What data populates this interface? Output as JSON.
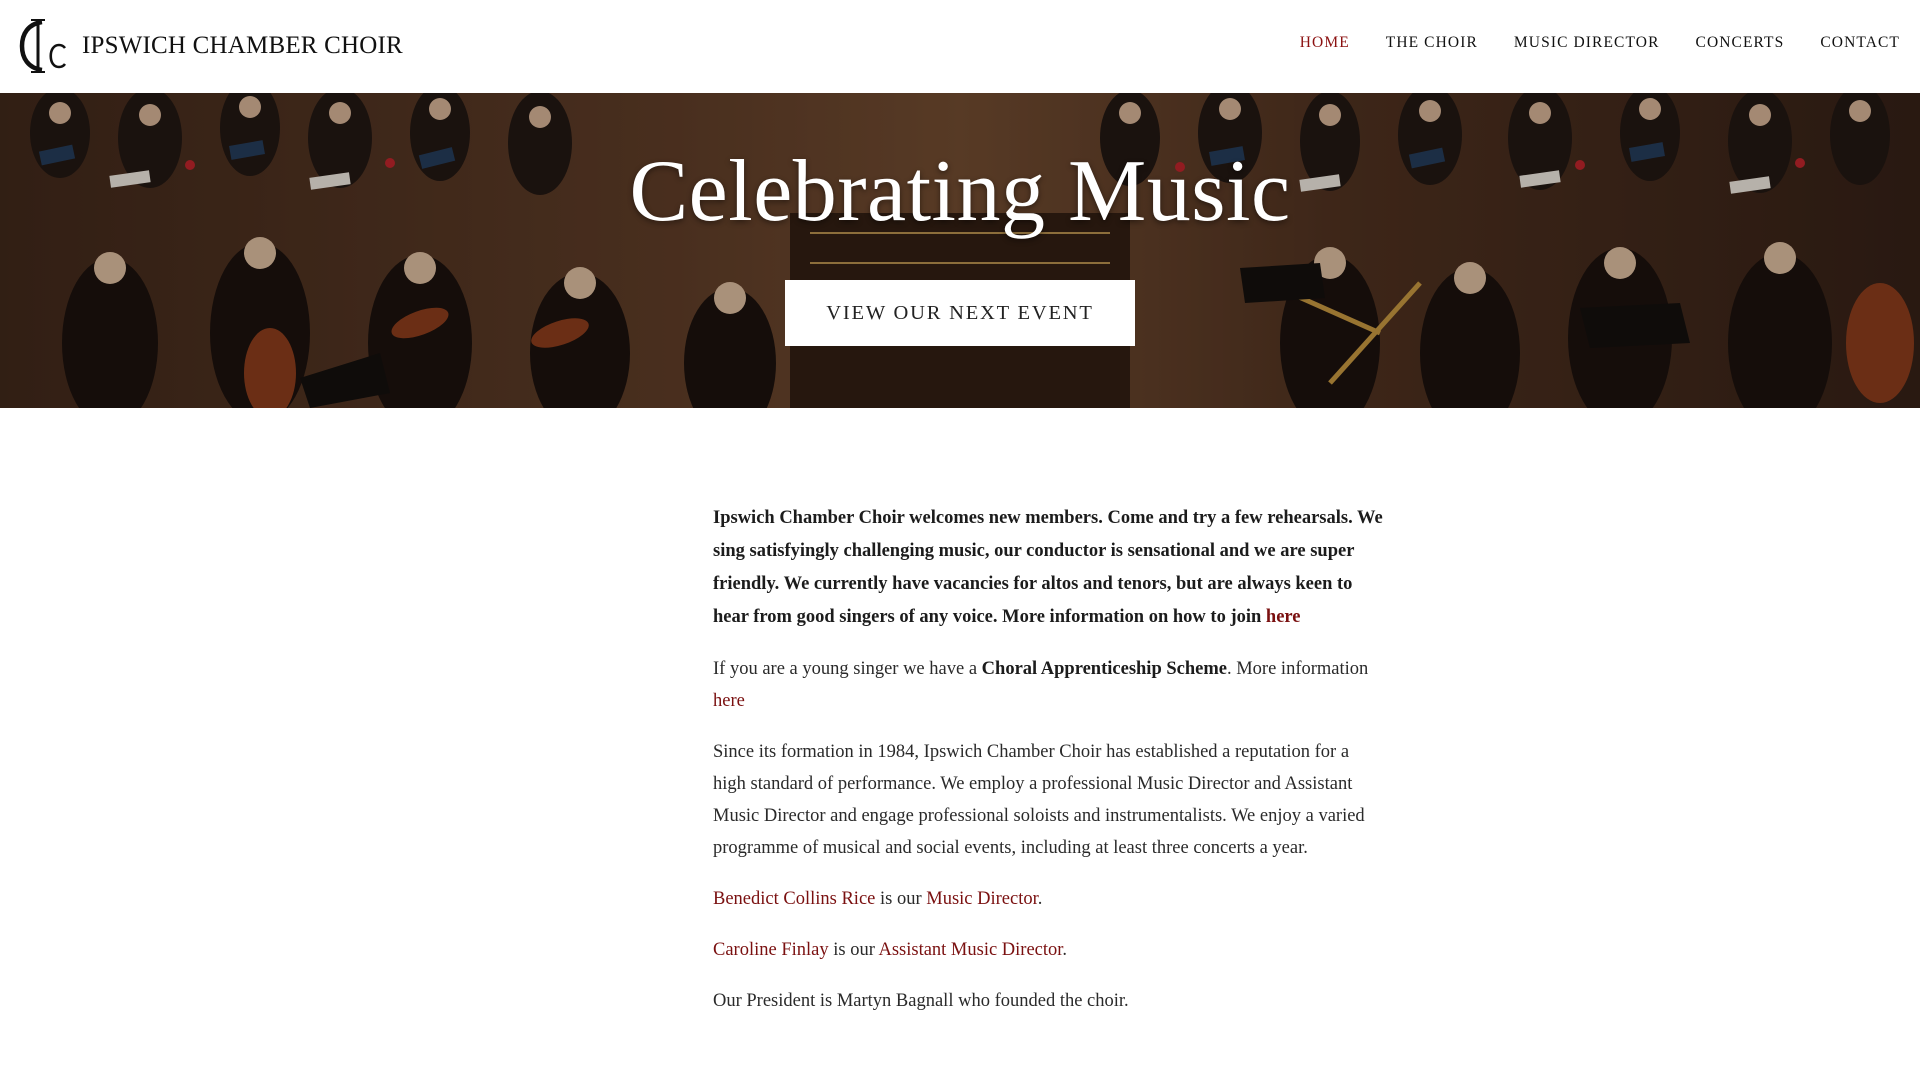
{
  "site": {
    "name": "IPSWICH CHAMBER CHOIR",
    "colors": {
      "accent": "#8b1111",
      "link": "#7a1010",
      "text": "#222222",
      "background": "#ffffff"
    }
  },
  "nav": {
    "items": [
      {
        "label": "HOME",
        "active": true
      },
      {
        "label": "THE CHOIR",
        "active": false
      },
      {
        "label": "MUSIC DIRECTOR",
        "active": false
      },
      {
        "label": "CONCERTS",
        "active": false
      },
      {
        "label": "CONTACT",
        "active": false
      }
    ]
  },
  "hero": {
    "title": "Celebrating Music",
    "button_label": "VIEW OUR NEXT EVENT"
  },
  "content": {
    "welcome_text": "Ipswich Chamber Choir welcomes new members.  Come and try a few rehearsals.  We sing satisfyingly challenging music, our conductor is sensational and we are super friendly.  We currently have vacancies for altos and tenors, but are always keen to hear from good singers of any voice.  More information on how to join ",
    "welcome_link": "here",
    "apprentice_text_1": "If you are a young singer we have a ",
    "apprentice_bold": "Choral Apprenticeship Scheme",
    "apprentice_text_2": ".  More information ",
    "apprentice_link": "here",
    "history": "Since its formation in 1984, Ipswich Chamber Choir has established a reputation for a high standard of performance. We employ a professional Music Director and Assistant Music Director and engage professional soloists and instrumentalists.  We enjoy a varied programme of musical and social events, including at least three concerts a year.",
    "director_name": "Benedict Collins Rice",
    "director_mid": " is our ",
    "director_role": "Music Director",
    "director_end": ".",
    "assistant_name": "Caroline Finlay",
    "assistant_mid": " is our ",
    "assistant_role": "Assistant Music Director",
    "assistant_end": ".",
    "president": "Our President is Martyn Bagnall who founded the choir."
  }
}
